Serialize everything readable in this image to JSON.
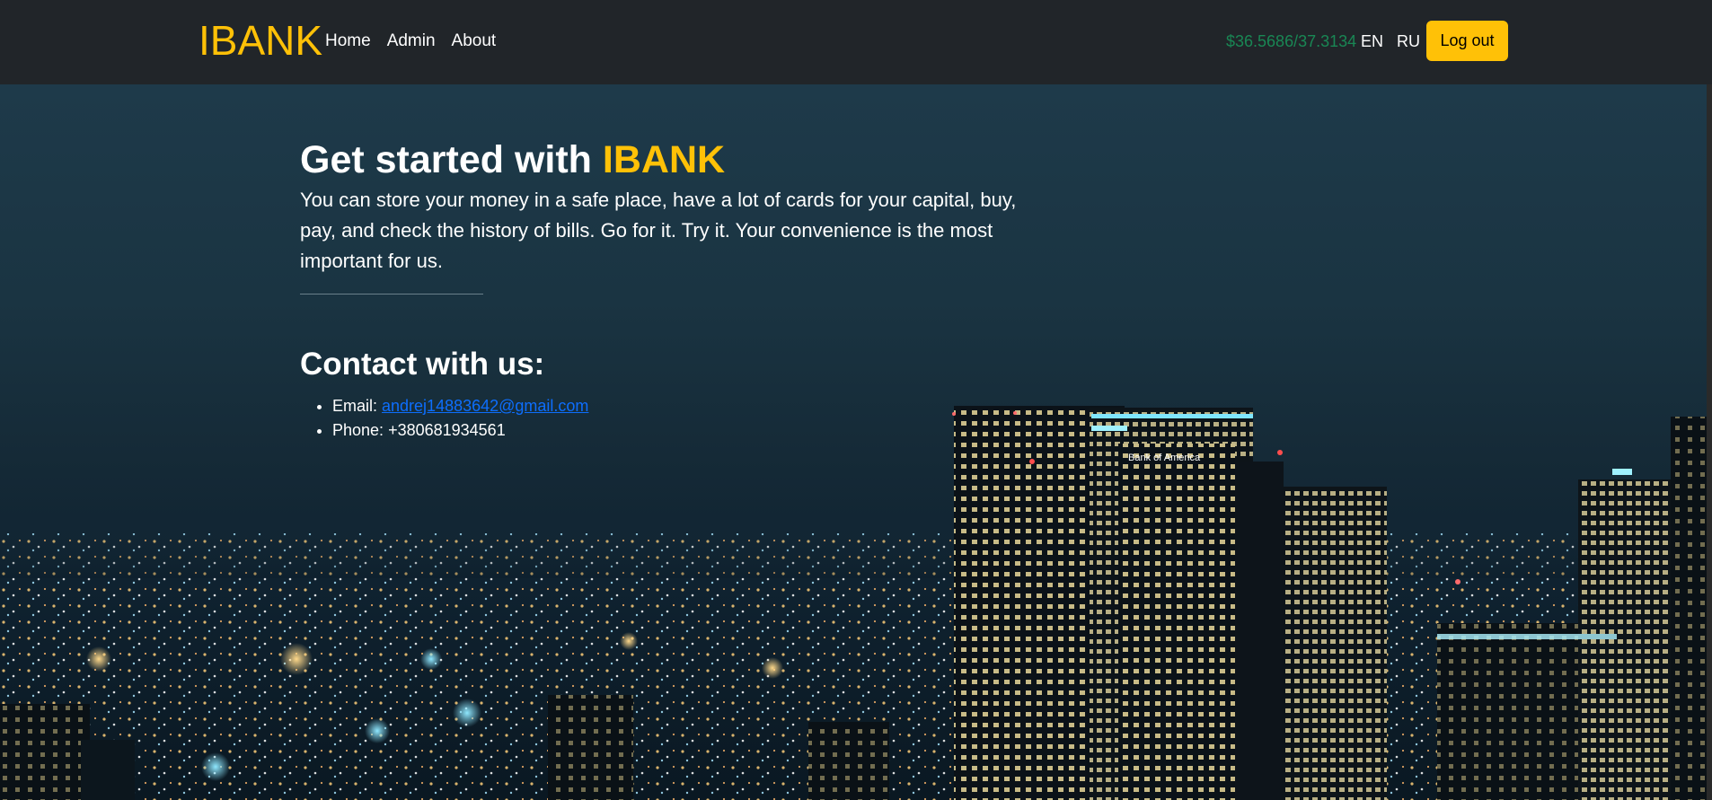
{
  "navbar": {
    "brand": "IBANK",
    "links": [
      "Home",
      "Admin",
      "About"
    ],
    "exchange_rate": "$36.5686/37.3134",
    "languages": [
      "EN",
      "RU"
    ],
    "logout_label": "Log out"
  },
  "hero": {
    "title_prefix": "Get started with ",
    "title_accent": "IBANK",
    "description": "You can store your money in a safe place, have a lot of cards for your capital, buy, pay, and check the history of bills. Go for it. Try it. Your convenience is the most important for us.",
    "contact_title": "Contact with us:",
    "email_label": "Email: ",
    "email_value": "andrej14883642@gmail.com",
    "phone_label": "Phone: ",
    "phone_value": "+380681934561",
    "building_sign": "Bank of America"
  },
  "colors": {
    "accent": "#ffc107",
    "navbar_bg": "#212529",
    "rate_text": "#198754",
    "link": "#0d6efd"
  }
}
